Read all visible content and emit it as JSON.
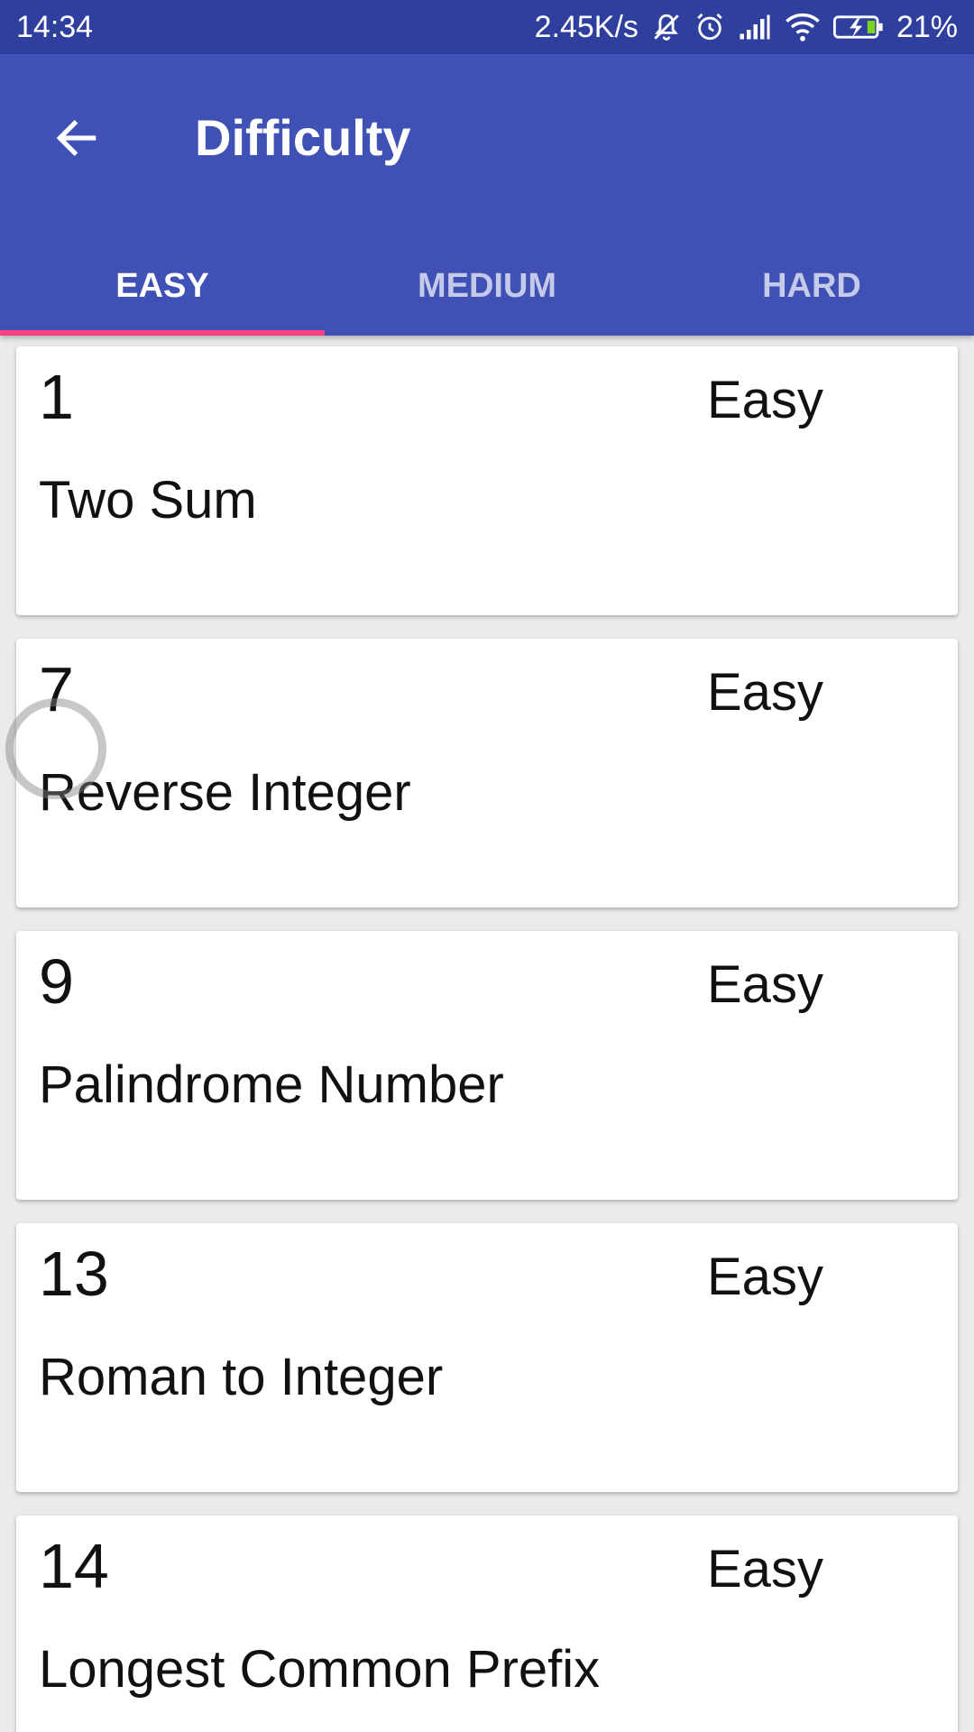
{
  "status_bar": {
    "time": "14:34",
    "net_speed": "2.45K/s",
    "battery": "21%"
  },
  "app_bar": {
    "title": "Difficulty",
    "color": "#3f51b5"
  },
  "tabs": [
    {
      "label": "EASY",
      "active": true
    },
    {
      "label": "MEDIUM",
      "active": false
    },
    {
      "label": "HARD",
      "active": false
    }
  ],
  "accent_color": "#ff4081",
  "problems": [
    {
      "number": "1",
      "difficulty": "Easy",
      "title": "Two Sum"
    },
    {
      "number": "7",
      "difficulty": "Easy",
      "title": "Reverse Integer"
    },
    {
      "number": "9",
      "difficulty": "Easy",
      "title": "Palindrome Number"
    },
    {
      "number": "13",
      "difficulty": "Easy",
      "title": "Roman to Integer"
    },
    {
      "number": "14",
      "difficulty": "Easy",
      "title": "Longest Common Prefix"
    }
  ]
}
